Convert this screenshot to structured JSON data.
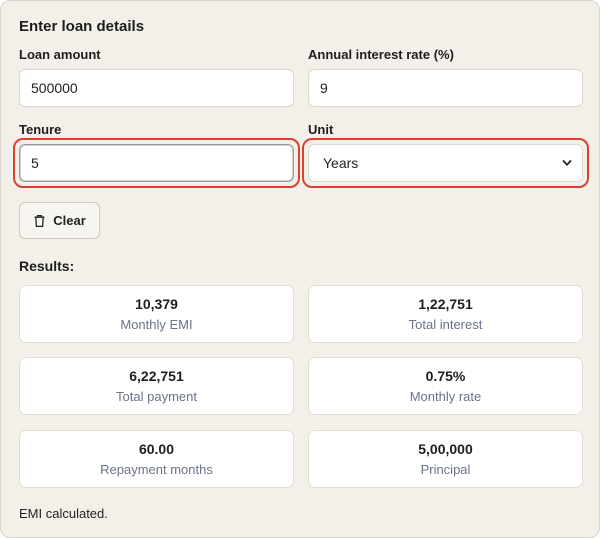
{
  "form": {
    "heading": "Enter loan details",
    "loan_amount": {
      "label": "Loan amount",
      "value": "500000"
    },
    "interest_rate": {
      "label": "Annual interest rate (%)",
      "value": "9"
    },
    "tenure": {
      "label": "Tenure",
      "value": "5"
    },
    "unit": {
      "label": "Unit",
      "selected": "Years"
    },
    "clear_label": "Clear"
  },
  "results": {
    "label": "Results:",
    "cards": [
      {
        "value": "10,379",
        "caption": "Monthly EMI"
      },
      {
        "value": "1,22,751",
        "caption": "Total interest"
      },
      {
        "value": "6,22,751",
        "caption": "Total payment"
      },
      {
        "value": "0.75%",
        "caption": "Monthly rate"
      },
      {
        "value": "60.00",
        "caption": "Repayment months"
      },
      {
        "value": "5,00,000",
        "caption": "Principal"
      }
    ]
  },
  "status": "EMI calculated.",
  "colors": {
    "highlight": "#d9422c",
    "caption": "#6b7389",
    "panel": "#f3f0e9"
  },
  "icons": {
    "clear": "trash-icon",
    "select": "chevron-down-icon"
  }
}
